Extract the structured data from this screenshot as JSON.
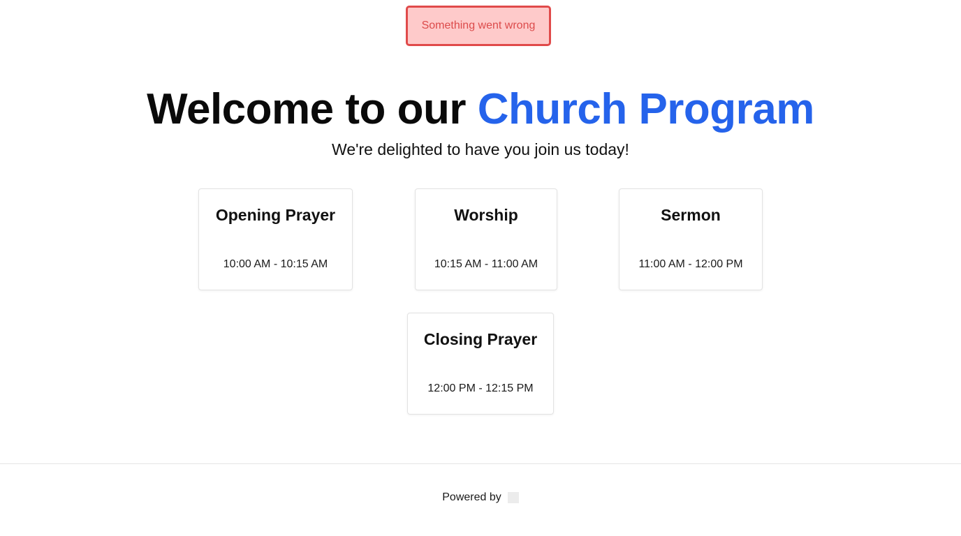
{
  "error": {
    "message": "Something went wrong"
  },
  "hero": {
    "title_prefix": "Welcome to our ",
    "title_accent": "Church Program",
    "subtitle": "We're delighted to have you join us today!"
  },
  "program": {
    "items": [
      {
        "title": "Opening Prayer",
        "time": "10:00 AM - 10:15 AM"
      },
      {
        "title": "Worship",
        "time": "10:15 AM - 11:00 AM"
      },
      {
        "title": "Sermon",
        "time": "11:00 AM - 12:00 PM"
      },
      {
        "title": "Closing Prayer",
        "time": "12:00 PM - 12:15 PM"
      }
    ]
  },
  "footer": {
    "powered_by": "Powered by",
    "logo_icon": "brand-logo-placeholder"
  },
  "colors": {
    "accent": "#2563eb",
    "error_background": "#fecaca",
    "error_border": "#e04a4a",
    "error_text": "#dc4b4b"
  }
}
